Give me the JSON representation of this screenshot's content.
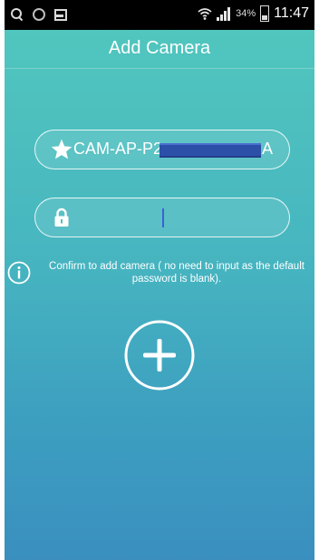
{
  "status_bar": {
    "left_icons": [
      "search-icon",
      "messenger-icon",
      "image-icon"
    ],
    "right_icons": [
      "wifi-icon",
      "signal-icon",
      "battery-icon"
    ],
    "battery_percent": "34%",
    "time": "11:47"
  },
  "header": {
    "title": "Add Camera"
  },
  "form": {
    "ssid": {
      "icon": "star-icon",
      "value_prefix": "CAM-AP-P2",
      "value_suffix": "A",
      "redacted": true
    },
    "password": {
      "icon": "lock-icon",
      "value": "",
      "placeholder": ""
    }
  },
  "hint": {
    "icon": "info-icon",
    "text": "Confirm to add camera ( no need to input as the default password is blank)."
  },
  "actions": {
    "add_button_icon": "plus-icon"
  },
  "colors": {
    "gradient_top": "#52c8bd",
    "gradient_bottom": "#3a8fbf",
    "redaction": "#2c4fa8",
    "text": "#ffffff"
  }
}
